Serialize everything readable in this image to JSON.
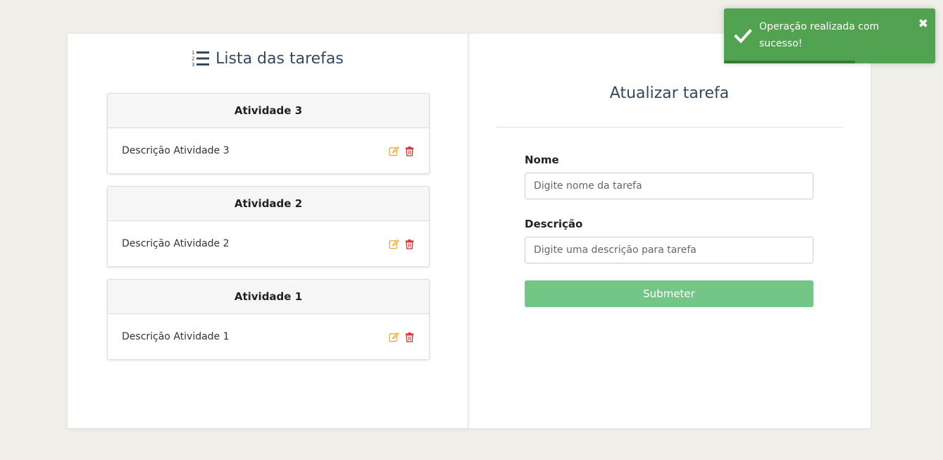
{
  "tasks_panel": {
    "title": "Lista das tarefas",
    "items": [
      {
        "name": "Atividade 3",
        "description": "Descrição Atividade 3"
      },
      {
        "name": "Atividade 2",
        "description": "Descrição Atividade 2"
      },
      {
        "name": "Atividade 1",
        "description": "Descrição Atividade 1"
      }
    ]
  },
  "form_panel": {
    "title": "Atualizar tarefa",
    "name_label": "Nome",
    "name_placeholder": "Digite nome da tarefa",
    "name_value": "",
    "description_label": "Descrição",
    "description_placeholder": "Digite uma descrição para tarefa",
    "description_value": "",
    "submit_label": "Submeter"
  },
  "toast": {
    "message": "Operação realizada com sucesso!",
    "close_glyph": "✖",
    "progress_percent": 62
  },
  "colors": {
    "edit_icon": "#f0ad2e",
    "delete_icon": "#d9383a",
    "title_text": "#34495e",
    "toast_bg": "#51a351",
    "submit_bg": "#74c687"
  }
}
